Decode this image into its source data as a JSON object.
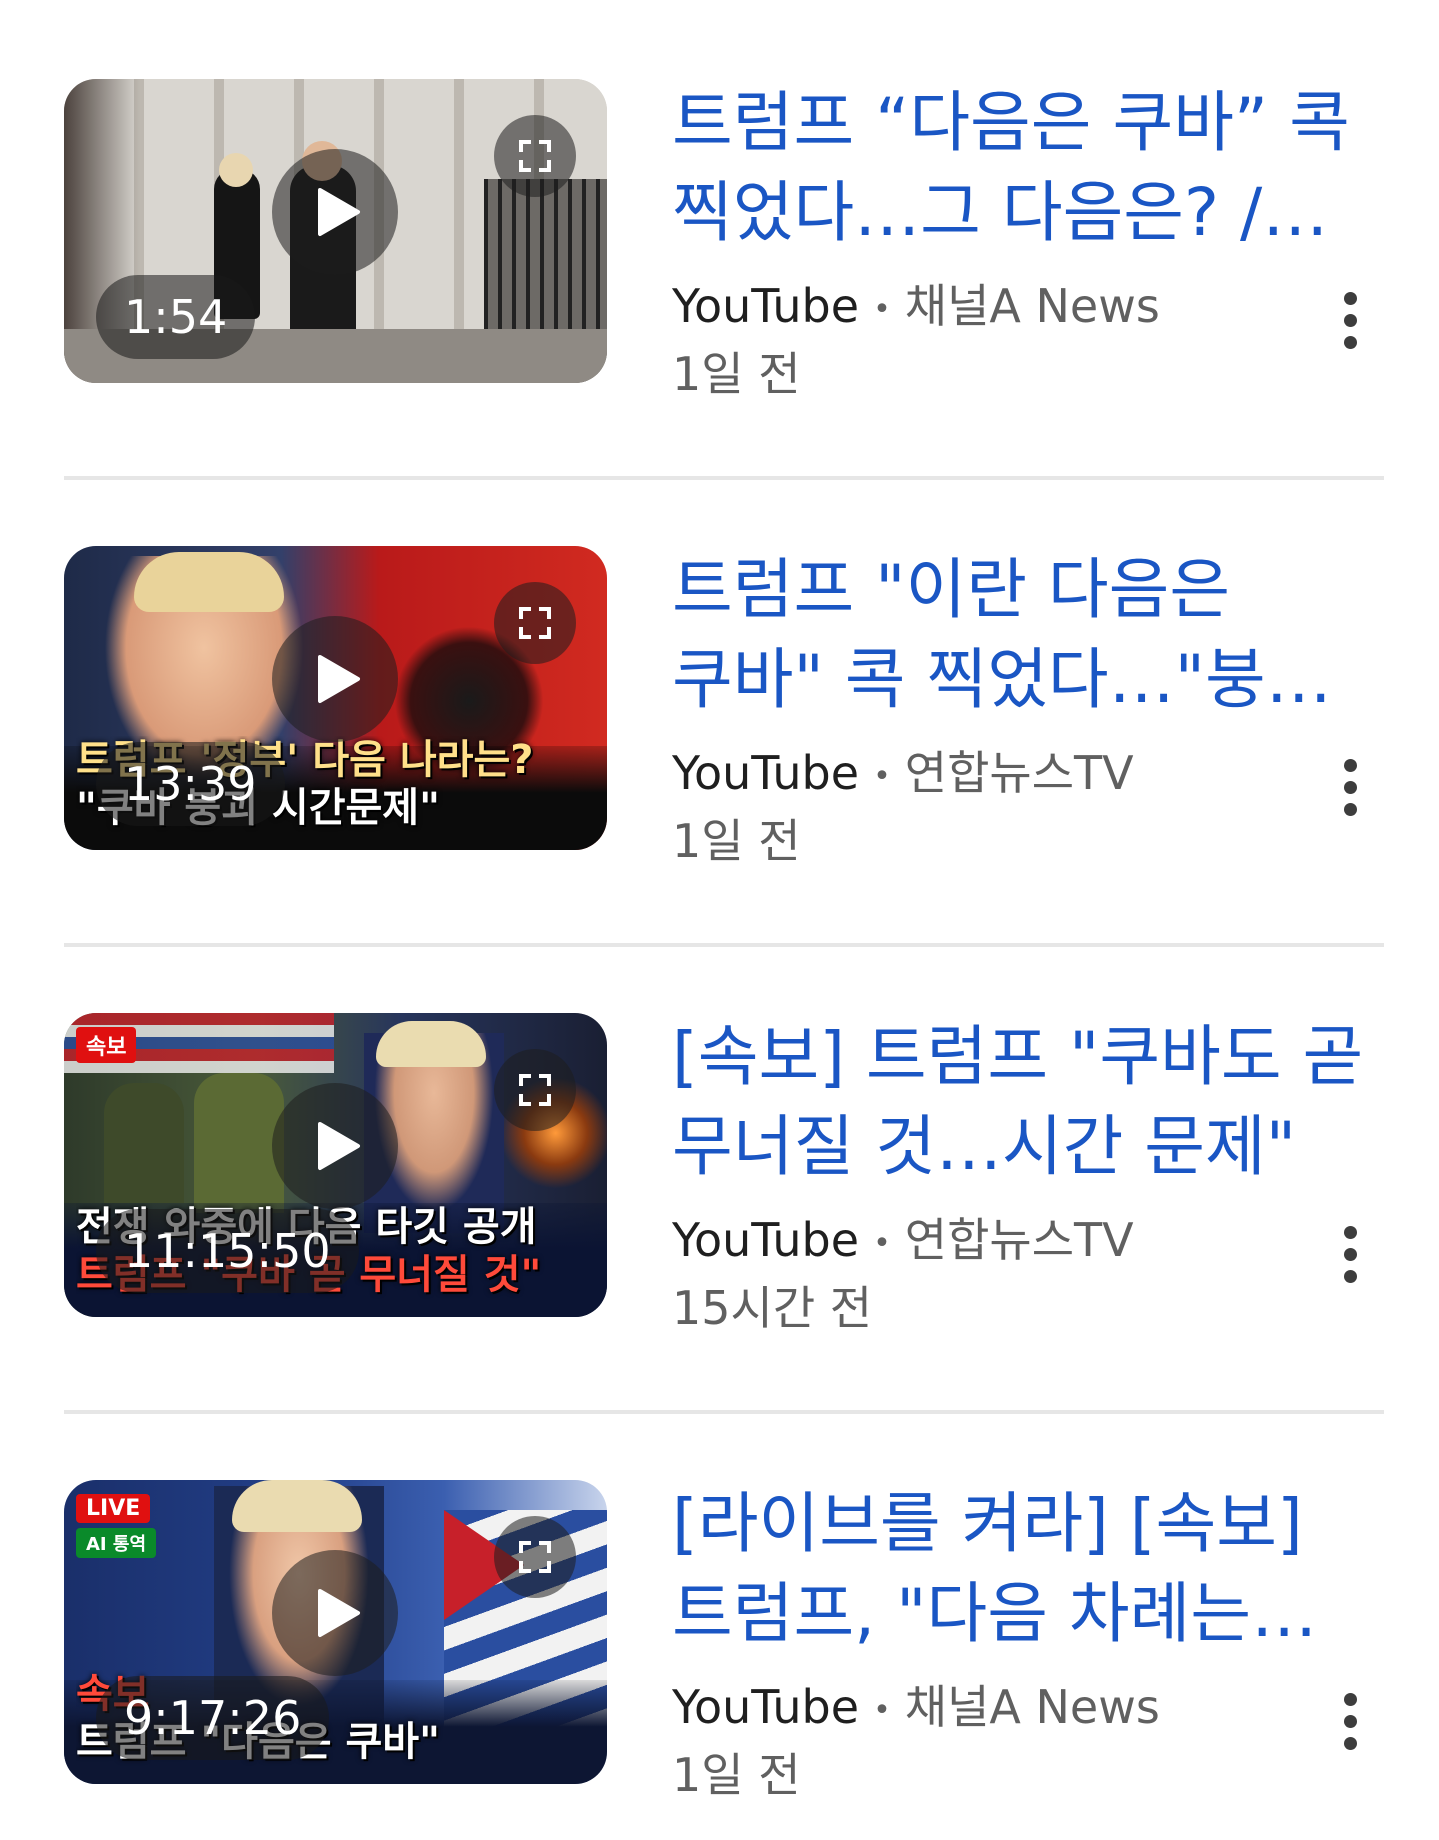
{
  "results": [
    {
      "title": "트럼프 “다음은 쿠바” 콕 찍었다…그 다음은? / 채널A / 뉴스A",
      "source": "YouTube",
      "channel": "채널A News",
      "age": "1일 전",
      "duration": "1:54",
      "thumb": {
        "tag": "",
        "tag2": "",
        "caption1": "",
        "caption2": ""
      }
    },
    {
      "title": "트럼프 \"이란 다음은 쿠바\" 콕 찍었다…\"붕괴는 시간문제\"",
      "source": "YouTube",
      "channel": "연합뉴스TV",
      "age": "1일 전",
      "duration": "13:39",
      "thumb": {
        "tag": "",
        "tag2": "",
        "caption1": "트럼프 '정부' 다음 나라는?",
        "caption2": "\"쿠바 붕괴 시간문제\""
      }
    },
    {
      "title": "[속보] 트럼프 \"쿠바도 곧 무너질 것…시간 문제\"",
      "source": "YouTube",
      "channel": "연합뉴스TV",
      "age": "15시간 전",
      "duration": "11:15:50",
      "thumb": {
        "tag": "속보",
        "tag2": "",
        "caption1": "전쟁 와중에 다음 타깃 공개",
        "caption2": "트럼프 \"쿠바 곧 무너질 것\""
      }
    },
    {
      "title": "[라이브를 켜라] [속보] 트럼프, \"다음 차례는 쿠바\"",
      "source": "YouTube",
      "channel": "채널A News",
      "age": "1일 전",
      "duration": "9:17:26",
      "thumb": {
        "tag": "LIVE",
        "tag2": "AI 통역",
        "caption1": "속보",
        "caption2": "트럼프 \"다음은 쿠바\""
      }
    }
  ],
  "icons": {
    "play": "play-icon",
    "expand": "expand-icon",
    "more": "more-vert-icon"
  },
  "colors": {
    "title": "#1a56c4",
    "meta": "#606060",
    "divider": "#e6e6e6"
  }
}
